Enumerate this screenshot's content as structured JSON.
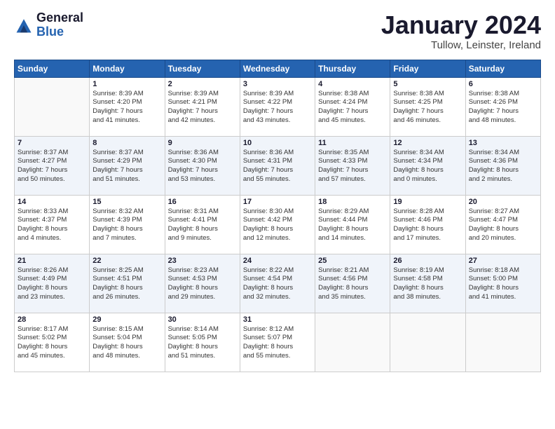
{
  "header": {
    "logo_general": "General",
    "logo_blue": "Blue",
    "title": "January 2024",
    "location": "Tullow, Leinster, Ireland"
  },
  "days_of_week": [
    "Sunday",
    "Monday",
    "Tuesday",
    "Wednesday",
    "Thursday",
    "Friday",
    "Saturday"
  ],
  "weeks": [
    [
      {
        "day": "",
        "info": ""
      },
      {
        "day": "1",
        "info": "Sunrise: 8:39 AM\nSunset: 4:20 PM\nDaylight: 7 hours\nand 41 minutes."
      },
      {
        "day": "2",
        "info": "Sunrise: 8:39 AM\nSunset: 4:21 PM\nDaylight: 7 hours\nand 42 minutes."
      },
      {
        "day": "3",
        "info": "Sunrise: 8:39 AM\nSunset: 4:22 PM\nDaylight: 7 hours\nand 43 minutes."
      },
      {
        "day": "4",
        "info": "Sunrise: 8:38 AM\nSunset: 4:24 PM\nDaylight: 7 hours\nand 45 minutes."
      },
      {
        "day": "5",
        "info": "Sunrise: 8:38 AM\nSunset: 4:25 PM\nDaylight: 7 hours\nand 46 minutes."
      },
      {
        "day": "6",
        "info": "Sunrise: 8:38 AM\nSunset: 4:26 PM\nDaylight: 7 hours\nand 48 minutes."
      }
    ],
    [
      {
        "day": "7",
        "info": "Sunrise: 8:37 AM\nSunset: 4:27 PM\nDaylight: 7 hours\nand 50 minutes."
      },
      {
        "day": "8",
        "info": "Sunrise: 8:37 AM\nSunset: 4:29 PM\nDaylight: 7 hours\nand 51 minutes."
      },
      {
        "day": "9",
        "info": "Sunrise: 8:36 AM\nSunset: 4:30 PM\nDaylight: 7 hours\nand 53 minutes."
      },
      {
        "day": "10",
        "info": "Sunrise: 8:36 AM\nSunset: 4:31 PM\nDaylight: 7 hours\nand 55 minutes."
      },
      {
        "day": "11",
        "info": "Sunrise: 8:35 AM\nSunset: 4:33 PM\nDaylight: 7 hours\nand 57 minutes."
      },
      {
        "day": "12",
        "info": "Sunrise: 8:34 AM\nSunset: 4:34 PM\nDaylight: 8 hours\nand 0 minutes."
      },
      {
        "day": "13",
        "info": "Sunrise: 8:34 AM\nSunset: 4:36 PM\nDaylight: 8 hours\nand 2 minutes."
      }
    ],
    [
      {
        "day": "14",
        "info": "Sunrise: 8:33 AM\nSunset: 4:37 PM\nDaylight: 8 hours\nand 4 minutes."
      },
      {
        "day": "15",
        "info": "Sunrise: 8:32 AM\nSunset: 4:39 PM\nDaylight: 8 hours\nand 7 minutes."
      },
      {
        "day": "16",
        "info": "Sunrise: 8:31 AM\nSunset: 4:41 PM\nDaylight: 8 hours\nand 9 minutes."
      },
      {
        "day": "17",
        "info": "Sunrise: 8:30 AM\nSunset: 4:42 PM\nDaylight: 8 hours\nand 12 minutes."
      },
      {
        "day": "18",
        "info": "Sunrise: 8:29 AM\nSunset: 4:44 PM\nDaylight: 8 hours\nand 14 minutes."
      },
      {
        "day": "19",
        "info": "Sunrise: 8:28 AM\nSunset: 4:46 PM\nDaylight: 8 hours\nand 17 minutes."
      },
      {
        "day": "20",
        "info": "Sunrise: 8:27 AM\nSunset: 4:47 PM\nDaylight: 8 hours\nand 20 minutes."
      }
    ],
    [
      {
        "day": "21",
        "info": "Sunrise: 8:26 AM\nSunset: 4:49 PM\nDaylight: 8 hours\nand 23 minutes."
      },
      {
        "day": "22",
        "info": "Sunrise: 8:25 AM\nSunset: 4:51 PM\nDaylight: 8 hours\nand 26 minutes."
      },
      {
        "day": "23",
        "info": "Sunrise: 8:23 AM\nSunset: 4:53 PM\nDaylight: 8 hours\nand 29 minutes."
      },
      {
        "day": "24",
        "info": "Sunrise: 8:22 AM\nSunset: 4:54 PM\nDaylight: 8 hours\nand 32 minutes."
      },
      {
        "day": "25",
        "info": "Sunrise: 8:21 AM\nSunset: 4:56 PM\nDaylight: 8 hours\nand 35 minutes."
      },
      {
        "day": "26",
        "info": "Sunrise: 8:19 AM\nSunset: 4:58 PM\nDaylight: 8 hours\nand 38 minutes."
      },
      {
        "day": "27",
        "info": "Sunrise: 8:18 AM\nSunset: 5:00 PM\nDaylight: 8 hours\nand 41 minutes."
      }
    ],
    [
      {
        "day": "28",
        "info": "Sunrise: 8:17 AM\nSunset: 5:02 PM\nDaylight: 8 hours\nand 45 minutes."
      },
      {
        "day": "29",
        "info": "Sunrise: 8:15 AM\nSunset: 5:04 PM\nDaylight: 8 hours\nand 48 minutes."
      },
      {
        "day": "30",
        "info": "Sunrise: 8:14 AM\nSunset: 5:05 PM\nDaylight: 8 hours\nand 51 minutes."
      },
      {
        "day": "31",
        "info": "Sunrise: 8:12 AM\nSunset: 5:07 PM\nDaylight: 8 hours\nand 55 minutes."
      },
      {
        "day": "",
        "info": ""
      },
      {
        "day": "",
        "info": ""
      },
      {
        "day": "",
        "info": ""
      }
    ]
  ]
}
